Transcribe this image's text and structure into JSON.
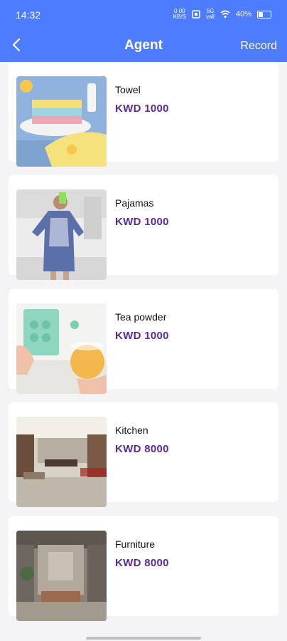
{
  "status": {
    "time": "14:32",
    "battery": "40%",
    "net1": "0.00\nKB/S",
    "net2": "5G\nvall"
  },
  "header": {
    "title": "Agent",
    "record_label": "Record"
  },
  "items": [
    {
      "name": "Towel",
      "price": "KWD 1000"
    },
    {
      "name": "Pajamas",
      "price": "KWD 1000"
    },
    {
      "name": "Tea powder",
      "price": "KWD 1000"
    },
    {
      "name": "Kitchen",
      "price": "KWD 8000"
    },
    {
      "name": "Furniture",
      "price": "KWD 8000"
    }
  ],
  "colors": {
    "primary": "#4d7cfe",
    "price": "#5b2a9a",
    "background": "#f4f4f6"
  }
}
